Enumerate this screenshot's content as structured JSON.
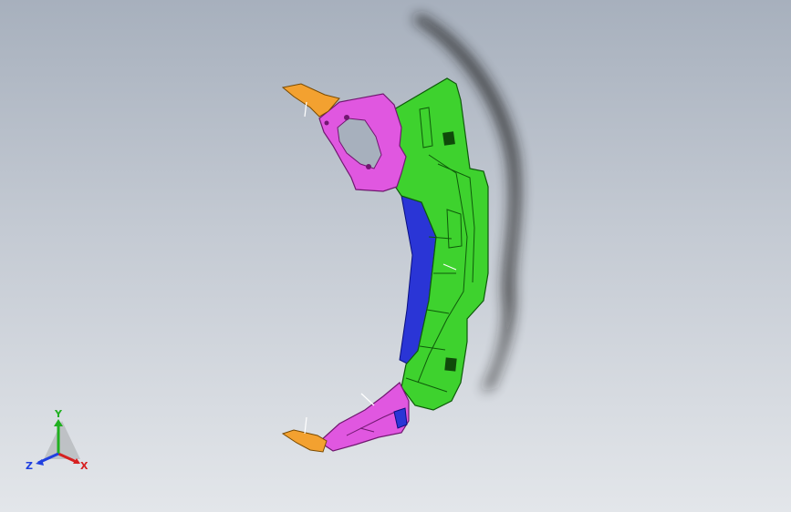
{
  "viewport": {
    "background_top": "#a7b0bd",
    "background_bottom": "#e3e6ea"
  },
  "model": {
    "parts": [
      {
        "name": "orange-clip",
        "color": "#f3a130"
      },
      {
        "name": "magenta-bracket",
        "color": "#e057e0"
      },
      {
        "name": "green-panel",
        "color": "#3ed22e"
      },
      {
        "name": "blue-reinforcement",
        "color": "#2a35d6"
      }
    ]
  },
  "triad": {
    "x_label": "X",
    "y_label": "Y",
    "z_label": "Z",
    "x_color": "#d62020",
    "y_color": "#20b020",
    "z_color": "#2040e0"
  }
}
